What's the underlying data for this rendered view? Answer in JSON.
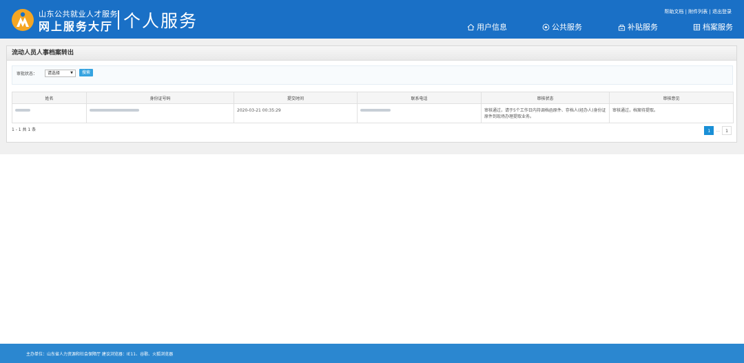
{
  "header": {
    "logo_line1": "山东公共就业人才服务",
    "logo_line2": "网上服务大厅",
    "logo_title": "个人服务",
    "top_links": [
      "帮助文档",
      "附件列表",
      "退出登录"
    ],
    "nav": [
      {
        "label": "用户信息",
        "icon": "home-icon"
      },
      {
        "label": "公共服务",
        "icon": "public-service-icon"
      },
      {
        "label": "补贴服务",
        "icon": "subsidy-icon"
      },
      {
        "label": "档案服务",
        "icon": "archive-icon"
      }
    ]
  },
  "panel": {
    "title": "流动人员人事档案转出",
    "filter": {
      "label": "审批状态：",
      "select_value": "请选择",
      "search_label": "搜索"
    },
    "table": {
      "columns": [
        "姓名",
        "身份证号码",
        "提交时间",
        "联系电话",
        "审核状态",
        "审核意见"
      ],
      "rows": [
        {
          "submit_time": "2020-03-21 00:35:29",
          "status": "审核通过，请于5个工作日内持调档函原件、存档人(经办人)身份证原件到现场办理提取业务。",
          "opinion": "审核通过，档案待提取。"
        }
      ]
    },
    "count_text": "1 - 1 共 1 条",
    "pager": {
      "current": "1",
      "dots": "...",
      "last": "1"
    }
  },
  "footer": {
    "text": "主办单位：山东省人力资源和社会保障厅   建议浏览器：IE11、谷歌、火狐浏览器"
  },
  "colors": {
    "header_bg": "#1a70c6",
    "footer_bg": "#2b87d0",
    "accent": "#1a8fd6",
    "logo_orange": "#f5a623"
  }
}
